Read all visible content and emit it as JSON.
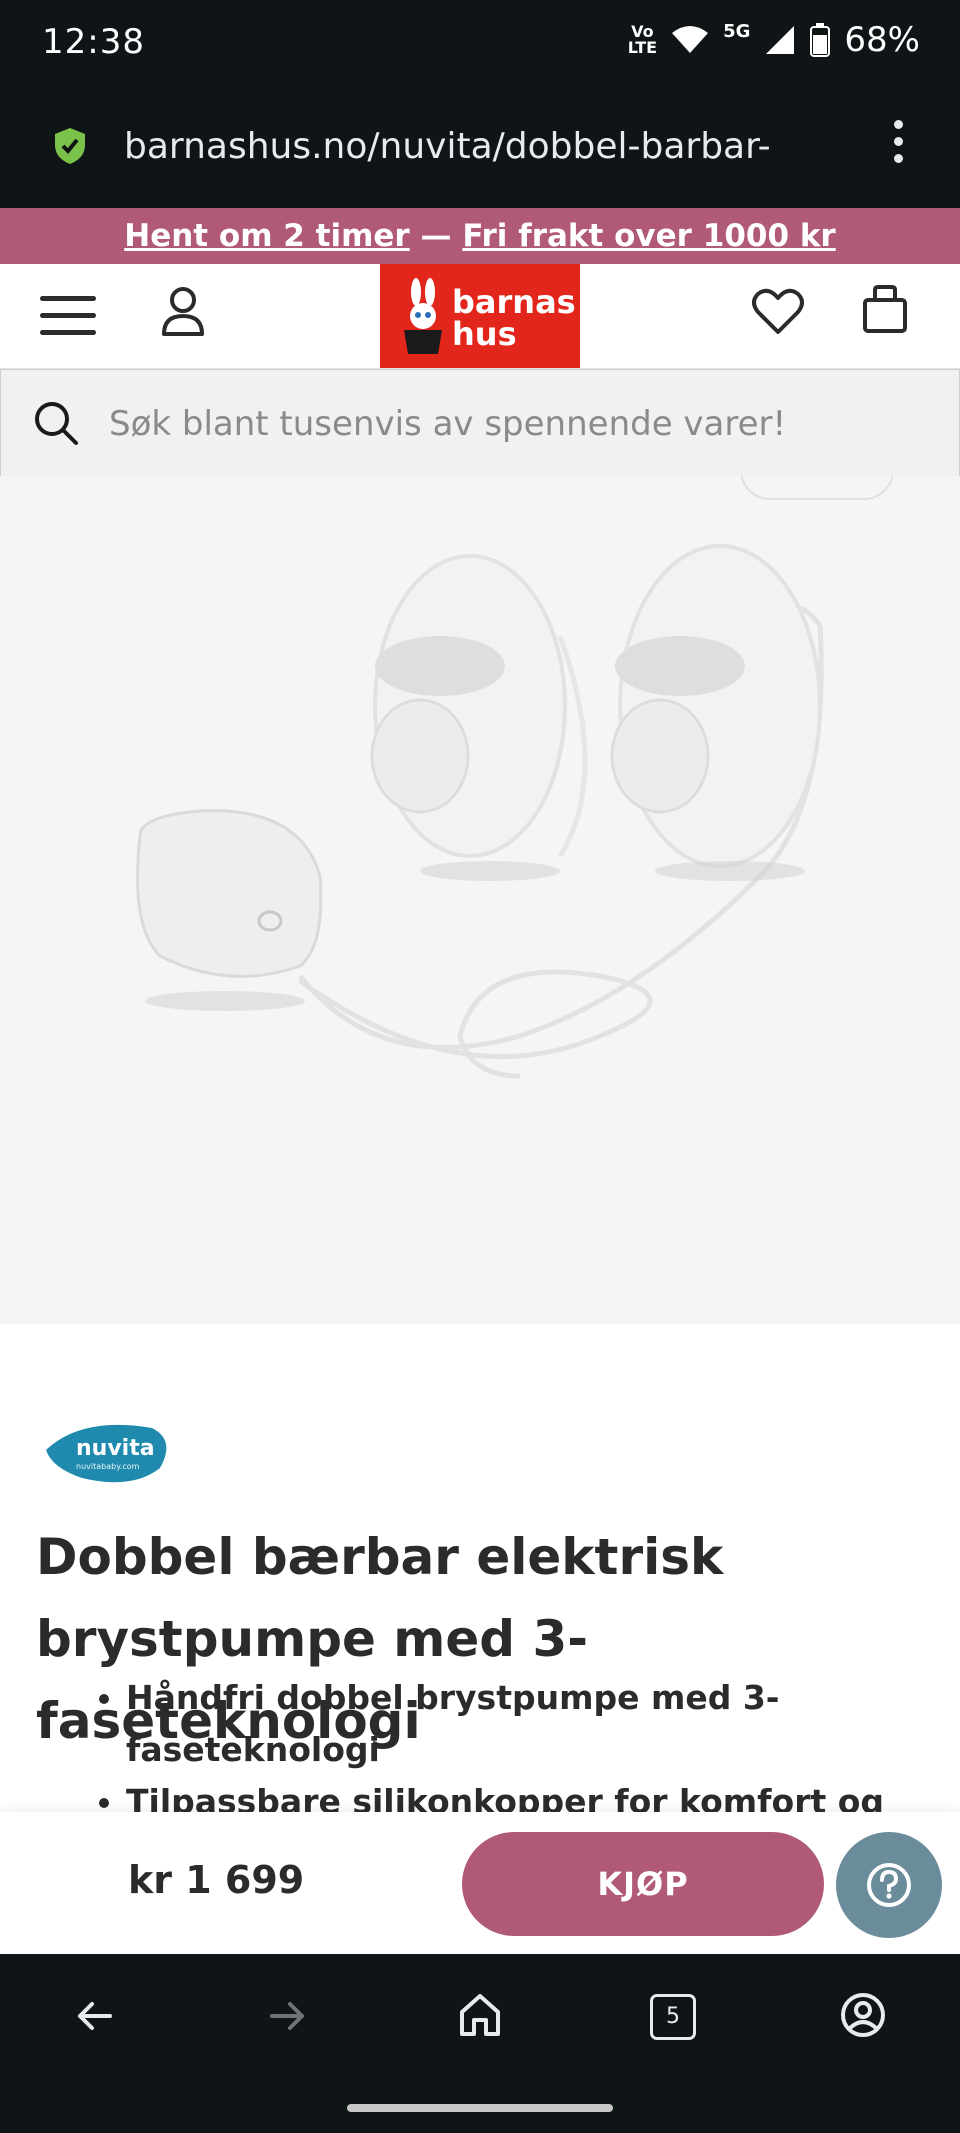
{
  "status_bar": {
    "time": "12:38",
    "network_label_top": "Vo",
    "network_label_bottom": "LTE",
    "signal_label": "5G",
    "battery": "68%"
  },
  "browser": {
    "url": "barnashus.no/nuvita/dobbel-barbar-"
  },
  "promo": {
    "pickup": "Hent om 2 timer",
    "separator": " — ",
    "shipping": "Fri frakt over 1000 kr"
  },
  "header": {
    "logo_line1": "barnas",
    "logo_line2": "hus"
  },
  "search": {
    "placeholder": "Søk blant tusenvis av spennende varer!"
  },
  "product": {
    "brand_logo_text": "nuvita",
    "brand_logo_subtext": "nuvitababy.com",
    "title": "Dobbel bærbar elektrisk brystpumpe med 3-faseteknologi",
    "bullets": [
      "Håndfri dobbel brystpumpe med 3-faseteknologi",
      "Tilpassbare silikonkopper for komfort og"
    ]
  },
  "buy_bar": {
    "price": "kr 1 699",
    "buy_label": "KJØP"
  },
  "nav": {
    "tab_count": "5"
  },
  "colors": {
    "accent": "#b15a78",
    "logo_red": "#e3261b",
    "dark_bar": "#0f1417",
    "help": "#6a8c9b"
  }
}
